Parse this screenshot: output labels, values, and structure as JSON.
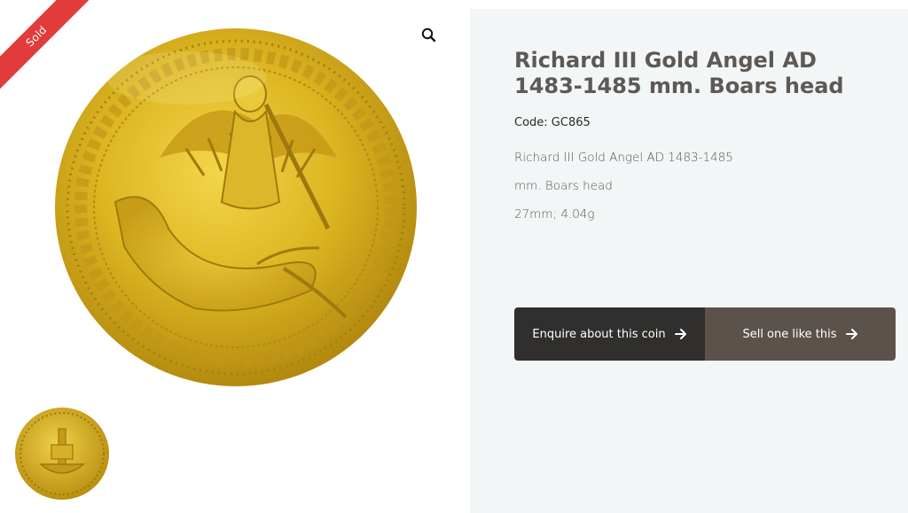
{
  "badge": {
    "sold_label": "Sold"
  },
  "gallery": {
    "zoom_icon": "magnifier-icon",
    "main_image": "gold-angel-coin-obverse",
    "thumbnail": "gold-angel-coin-reverse"
  },
  "product": {
    "title": "Richard III Gold Angel AD 1483-1485 mm. Boars head",
    "code_label": "Code: GC865",
    "description": [
      "Richard III Gold Angel AD 1483-1485",
      "mm. Boars head",
      "27mm; 4.04g"
    ]
  },
  "actions": {
    "enquire_label": "Enquire about this coin",
    "sell_label": "Sell one like this",
    "arrow_icon": "arrow-right-icon"
  },
  "colors": {
    "sold_red": "#e23b3b",
    "panel_bg": "#f3f6f6",
    "title": "#5d5954",
    "enquire_bg": "#302f2e",
    "sell_bg": "#5b524c",
    "gold": "#d9b21e"
  }
}
